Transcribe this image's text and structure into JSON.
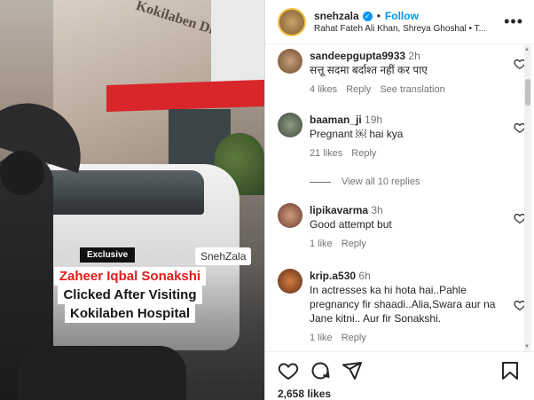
{
  "media": {
    "building_sign": "Kokilaben Dhirubhai",
    "exclusive_label": "Exclusive",
    "watermark": "SnehZala",
    "headline": [
      "Zaheer Iqbal Sonakshi",
      "Clicked After Visiting",
      "Kokilaben Hospital"
    ]
  },
  "header": {
    "username": "snehzala",
    "follow_label": "Follow",
    "audio": "Rahat Fateh Ali Khan, Shreya Ghoshal • T...",
    "more_icon": "more-horizontal-icon"
  },
  "comments": [
    {
      "user": "sandeepgupta9933",
      "time": "2h",
      "text": "सत्तू सदमा बर्दाश्त नहीं कर पाए",
      "likes": "4 likes",
      "reply": "Reply",
      "extra": "See translation"
    },
    {
      "user": "baaman_ji",
      "time": "19h",
      "text": "Pregnant ￼ hai kya",
      "likes": "21 likes",
      "reply": "Reply"
    },
    {
      "user": "lipikavarma",
      "time": "3h",
      "text": "Good attempt but",
      "likes": "1 like",
      "reply": "Reply"
    },
    {
      "user": "krip.a530",
      "time": "6h",
      "text": "In actresses ka hi hota hai..Pahle pregnancy fir shaadi..Alia,Swara aur na Jane kitni.. Aur fir Sonakshi.",
      "likes": "1 like",
      "reply": "Reply"
    }
  ],
  "view_replies": "View all 10 replies",
  "actions": {
    "likes": "2,658 likes"
  },
  "colors": {
    "accent": "#0095f6",
    "muted": "#737373",
    "text": "#262626"
  }
}
